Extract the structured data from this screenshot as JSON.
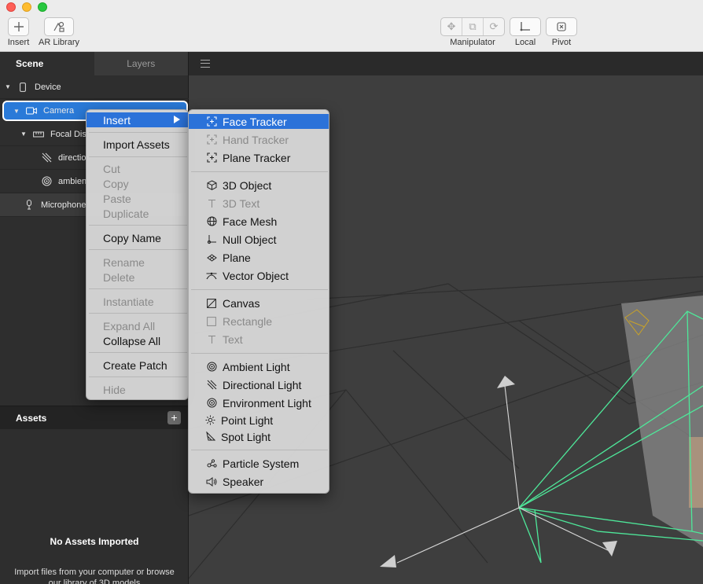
{
  "toolbar": {
    "insert_label": "Insert",
    "ar_library_label": "AR Library",
    "manipulator_label": "Manipulator",
    "local_label": "Local",
    "pivot_label": "Pivot"
  },
  "scene_panel": {
    "tabs": [
      {
        "label": "Scene",
        "active": true
      },
      {
        "label": "Layers",
        "active": false
      }
    ],
    "tree": [
      {
        "label": "Device",
        "icon": "phone-icon"
      },
      {
        "label": "Camera",
        "icon": "camera-icon"
      },
      {
        "label": "Focal Dis",
        "icon": "ruler-icon"
      },
      {
        "label": "directio",
        "icon": "directional-light-icon"
      },
      {
        "label": "ambien",
        "icon": "ambient-light-icon"
      },
      {
        "label": "Microphone",
        "icon": "microphone-icon"
      }
    ]
  },
  "assets_panel": {
    "title": "Assets",
    "add_label": "+",
    "empty_title": "No Assets Imported",
    "empty_help": "Import files from your computer or browse our library of 3D models"
  },
  "context_menu": {
    "items": [
      {
        "label": "Insert",
        "disabled": false,
        "highlighted": true
      },
      {
        "label": "Import Assets",
        "disabled": false
      },
      {
        "label": "Cut",
        "disabled": true
      },
      {
        "label": "Copy",
        "disabled": true
      },
      {
        "label": "Paste",
        "disabled": true
      },
      {
        "label": "Duplicate",
        "disabled": true
      },
      {
        "label": "Copy Name",
        "disabled": false
      },
      {
        "label": "Rename",
        "disabled": true
      },
      {
        "label": "Delete",
        "disabled": true
      },
      {
        "label": "Instantiate",
        "disabled": true
      },
      {
        "label": "Expand All",
        "disabled": true
      },
      {
        "label": "Collapse All",
        "disabled": false
      },
      {
        "label": "Create Patch",
        "disabled": false
      },
      {
        "label": "Hide",
        "disabled": true
      }
    ]
  },
  "insert_submenu": {
    "items": [
      {
        "label": "Face Tracker",
        "icon": "face-tracker-icon",
        "disabled": false,
        "highlighted": true
      },
      {
        "label": "Hand Tracker",
        "icon": "hand-tracker-icon",
        "disabled": true
      },
      {
        "label": "Plane Tracker",
        "icon": "plane-tracker-icon",
        "disabled": false
      },
      {
        "label": "3D Object",
        "icon": "cube-icon",
        "disabled": false
      },
      {
        "label": "3D Text",
        "icon": "text-icon",
        "disabled": true
      },
      {
        "label": "Face Mesh",
        "icon": "globe-icon",
        "disabled": false
      },
      {
        "label": "Null Object",
        "icon": "null-object-icon",
        "disabled": false
      },
      {
        "label": "Plane",
        "icon": "plane-icon",
        "disabled": false
      },
      {
        "label": "Vector Object",
        "icon": "vector-icon",
        "disabled": false
      },
      {
        "label": "Canvas",
        "icon": "canvas-icon",
        "disabled": false
      },
      {
        "label": "Rectangle",
        "icon": "rectangle-icon",
        "disabled": true
      },
      {
        "label": "Text",
        "icon": "text-icon",
        "disabled": true
      },
      {
        "label": "Ambient Light",
        "icon": "ambient-light-icon",
        "disabled": false
      },
      {
        "label": "Directional Light",
        "icon": "directional-light-icon",
        "disabled": false
      },
      {
        "label": "Environment Light",
        "icon": "environment-light-icon",
        "disabled": false
      },
      {
        "label": "Point Light",
        "icon": "point-light-icon",
        "disabled": false
      },
      {
        "label": "Spot Light",
        "icon": "spot-light-icon",
        "disabled": false
      },
      {
        "label": "Particle System",
        "icon": "particle-icon",
        "disabled": false
      },
      {
        "label": "Speaker",
        "icon": "speaker-icon",
        "disabled": false
      }
    ]
  },
  "colors": {
    "accent": "#2b72d9",
    "frustum": "#4ee89a",
    "panel": "#2e2e2e",
    "viewport": "#3e3e3e"
  }
}
